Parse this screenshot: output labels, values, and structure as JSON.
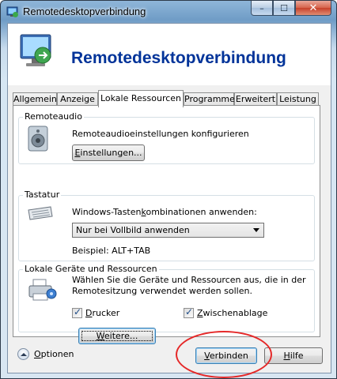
{
  "window": {
    "title": "Remotedesktopverbindung",
    "caption": {
      "minimize": "–",
      "maximize": "☐",
      "close": "✕"
    }
  },
  "banner": {
    "title": "Remotedesktopverbindung",
    "icon": "remote-desktop-monitor-icon"
  },
  "tabs": [
    {
      "label": "Allgemein",
      "active": false
    },
    {
      "label": "Anzeige",
      "active": false
    },
    {
      "label": "Lokale Ressourcen",
      "active": true
    },
    {
      "label": "Programme",
      "active": false
    },
    {
      "label": "Erweitert",
      "active": false
    },
    {
      "label": "Leistung",
      "active": false
    }
  ],
  "remote_audio": {
    "group_label": "Remoteaudio",
    "description": "Remoteaudioeinstellungen konfigurieren",
    "settings_button": {
      "underline": "E",
      "rest": "instellungen..."
    },
    "icon": "speaker-icon"
  },
  "keyboard": {
    "group_label": "Tastatur",
    "prompt_before": "Windows-Tasten",
    "prompt_underline": "k",
    "prompt_after": "ombinationen anwenden:",
    "selected": "Nur bei Vollbild anwenden",
    "example": "Beispiel: ALT+TAB",
    "icon": "keyboard-icon"
  },
  "local_devices": {
    "group_label": "Lokale Geräte und Ressourcen",
    "description_line1": "Wählen Sie die Geräte und Ressourcen aus, die in der",
    "description_line2": "Remotesitzung verwendet werden sollen.",
    "printer": {
      "underline": "D",
      "rest": "rucker",
      "checked": true
    },
    "clipboard": {
      "underline": "Z",
      "rest": "wischenablage",
      "checked": true
    },
    "more_button": {
      "underline": "W",
      "rest": "eitere..."
    },
    "icon": "devices-printer-icon"
  },
  "footer": {
    "options": {
      "underline": "O",
      "rest": "ptionen"
    },
    "connect": {
      "underline": "V",
      "rest": "erbinden"
    },
    "help": {
      "underline": "H",
      "rest": "ilfe"
    }
  },
  "colors": {
    "banner_title": "#003399",
    "annotation": "#e52929"
  }
}
